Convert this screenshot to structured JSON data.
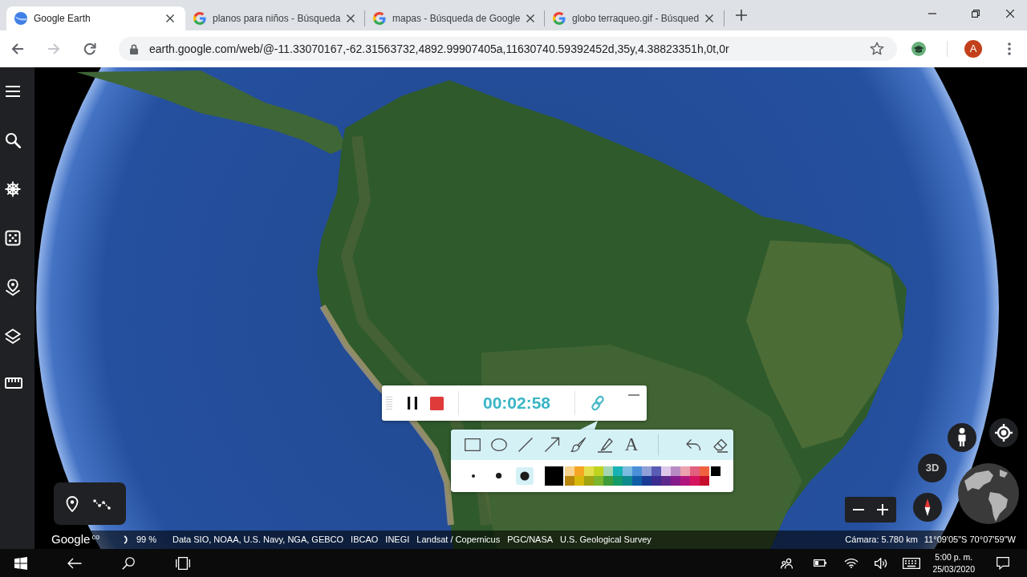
{
  "browser": {
    "tabs": [
      {
        "kind": "earth",
        "title": "Google Earth",
        "selected": true
      },
      {
        "kind": "google",
        "title": "planos para niños - Búsqueda",
        "selected": false
      },
      {
        "kind": "google",
        "title": "mapas - Búsqueda de Google",
        "selected": false
      },
      {
        "kind": "google",
        "title": "globo terraqueo.gif - Búsqued",
        "selected": false
      }
    ],
    "nav_buttons": [
      {
        "kind": "back",
        "disabled": false
      },
      {
        "kind": "forward",
        "disabled": true
      },
      {
        "kind": "reload",
        "disabled": false
      }
    ],
    "url": "earth.google.com/web/@-11.33070167,-62.31563732,4892.99907405a,11630740.59392452d,35y,4.38823351h,0t,0r",
    "bookmarked": false,
    "avatar": "A"
  },
  "sidebar": {
    "items": [
      {
        "kind": "menu"
      },
      {
        "kind": "search"
      },
      {
        "kind": "voyager"
      },
      {
        "kind": "lucky"
      },
      {
        "kind": "projects"
      },
      {
        "kind": "map_style"
      },
      {
        "kind": "measure"
      }
    ]
  },
  "recorder": {
    "time": "00:02:58"
  },
  "palette": {
    "tools": [
      {
        "kind": "rectangle"
      },
      {
        "kind": "ellipse"
      },
      {
        "kind": "line"
      },
      {
        "kind": "arrow"
      },
      {
        "kind": "brush"
      },
      {
        "kind": "highlighter"
      },
      {
        "kind": "text",
        "label": "A"
      }
    ],
    "actions": [
      {
        "kind": "undo"
      },
      {
        "kind": "eraser"
      }
    ],
    "sizes": [
      {
        "kind": "small",
        "selected": false
      },
      {
        "kind": "medium",
        "selected": false
      },
      {
        "kind": "large",
        "selected": true
      }
    ],
    "current": {
      "color": "#000000"
    },
    "swatch_rows": [
      {
        "swatches": [
          {
            "color": "#f8d38e"
          },
          {
            "color": "#f5a623"
          },
          {
            "color": "#e2df4c"
          },
          {
            "color": "#bfd41e"
          },
          {
            "color": "#a3d5b3"
          },
          {
            "color": "#17b2b4"
          },
          {
            "color": "#7bbbe0"
          },
          {
            "color": "#4a90d9"
          },
          {
            "color": "#8fa0d8"
          },
          {
            "color": "#5a5cb3"
          },
          {
            "color": "#dcc8e8"
          },
          {
            "color": "#b98bc5"
          },
          {
            "color": "#eba1ae"
          },
          {
            "color": "#e1607e"
          },
          {
            "color": "#ef613f"
          },
          {
            "color": "#000000"
          }
        ]
      },
      {
        "swatches": [
          {
            "color": "#b8860b"
          },
          {
            "color": "#d8b80a"
          },
          {
            "color": "#a0a312"
          },
          {
            "color": "#7cb52e"
          },
          {
            "color": "#3e9c3a"
          },
          {
            "color": "#159a69"
          },
          {
            "color": "#0e8b8d"
          },
          {
            "color": "#105ea8"
          },
          {
            "color": "#1a3a96"
          },
          {
            "color": "#3b2c90"
          },
          {
            "color": "#5c2a8c"
          },
          {
            "color": "#881b8b"
          },
          {
            "color": "#b1167e"
          },
          {
            "color": "#d6145e"
          },
          {
            "color": "#c70f2d"
          }
        ]
      }
    ]
  },
  "map_controls": {
    "view_mode": "3D"
  },
  "bottom_tools": [
    {
      "kind": "placemark"
    },
    {
      "kind": "path"
    }
  ],
  "status_bar": {
    "logo": "Google",
    "logo_suffix": "co",
    "loading": "99 %",
    "attributions": [
      "Data SIO, NOAA, U.S. Navy, NGA, GEBCO",
      "IBCAO",
      "INEGI",
      "Landsat / Copernicus",
      "PGC/NASA",
      "U.S. Geological Survey"
    ],
    "camera": "Cámara: 5.780 km",
    "coordinates": "11°09'05\"S 70°07'59\"W"
  },
  "taskbar": {
    "time": "5:00 p. m.",
    "date": "25/03/2020"
  }
}
